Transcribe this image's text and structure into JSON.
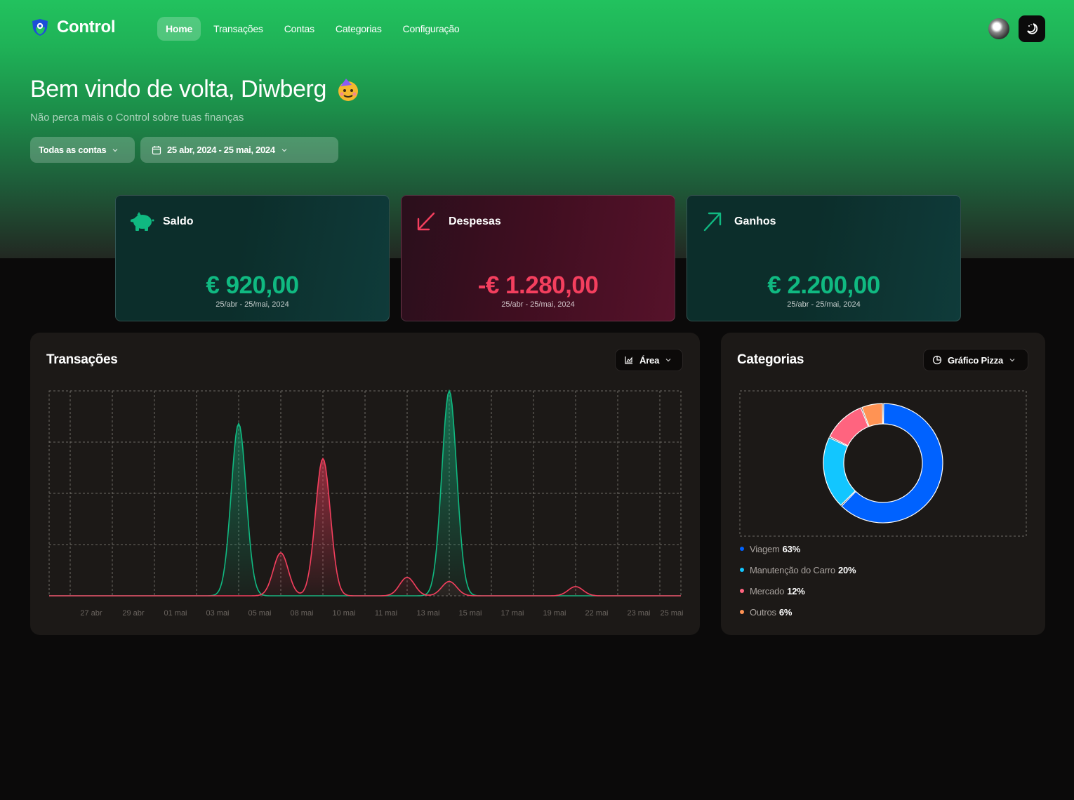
{
  "app": {
    "name": "Control"
  },
  "nav": [
    {
      "label": "Home",
      "active": true
    },
    {
      "label": "Transações",
      "active": false
    },
    {
      "label": "Contas",
      "active": false
    },
    {
      "label": "Categorias",
      "active": false
    },
    {
      "label": "Configuração",
      "active": false
    }
  ],
  "header": {
    "welcome": "Bem vindo de volta, Diwberg",
    "subtitle": "Não perca mais o Control sobre tuas finanças",
    "account_filter": "Todas as contas",
    "date_filter": "25 abr, 2024 - 25 mai, 2024"
  },
  "cards": {
    "saldo": {
      "title": "Saldo",
      "value": "€ 920,00",
      "range": "25/abr - 25/mai, 2024",
      "color": "#10b981"
    },
    "despesas": {
      "title": "Despesas",
      "value": "-€ 1.280,00",
      "range": "25/abr - 25/mai, 2024",
      "color": "#f43f5e"
    },
    "ganhos": {
      "title": "Ganhos",
      "value": "€ 2.200,00",
      "range": "25/abr - 25/mai, 2024",
      "color": "#10b981"
    }
  },
  "transactions": {
    "title": "Transações",
    "chart_type_label": "Área"
  },
  "categories": {
    "title": "Categorias",
    "chart_type_label": "Gráfico Pizza",
    "legend": [
      {
        "name": "Viagem",
        "pct": "63%",
        "color": "#0062ff"
      },
      {
        "name": "Manutenção do Carro",
        "pct": "20%",
        "color": "#12c6ff"
      },
      {
        "name": "Mercado",
        "pct": "12%",
        "color": "#ff647f"
      },
      {
        "name": "Outros",
        "pct": "6%",
        "color": "#ff9354"
      }
    ]
  },
  "chart_data": [
    {
      "type": "area",
      "title": "Transações",
      "x_ticks": [
        "27 abr",
        "29 abr",
        "01 mai",
        "03 mai",
        "05 mai",
        "08 mai",
        "10 mai",
        "11 mai",
        "13 mai",
        "15 mai",
        "17 mai",
        "19 mai",
        "22 mai",
        "23 mai",
        "25 mai"
      ],
      "ylim": [
        0,
        1000
      ],
      "grid": true,
      "series": [
        {
          "name": "income",
          "color": "#10b981",
          "points": [
            {
              "x": "05 mai",
              "y": 840
            },
            {
              "x": "15 mai",
              "y": 1000
            }
          ]
        },
        {
          "name": "expenses",
          "color": "#f43f5e",
          "points": [
            {
              "x": "08 mai",
              "y": 210
            },
            {
              "x": "10 mai",
              "y": 670
            },
            {
              "x": "13 mai",
              "y": 90
            },
            {
              "x": "15 mai",
              "y": 70
            },
            {
              "x": "22 mai",
              "y": 45
            }
          ]
        }
      ]
    },
    {
      "type": "pie",
      "title": "Categorias",
      "labels": [
        "Viagem",
        "Manutenção do Carro",
        "Mercado",
        "Outros"
      ],
      "values": [
        63,
        20,
        12,
        6
      ],
      "colors": [
        "#0062ff",
        "#12c6ff",
        "#ff647f",
        "#ff9354"
      ]
    }
  ]
}
